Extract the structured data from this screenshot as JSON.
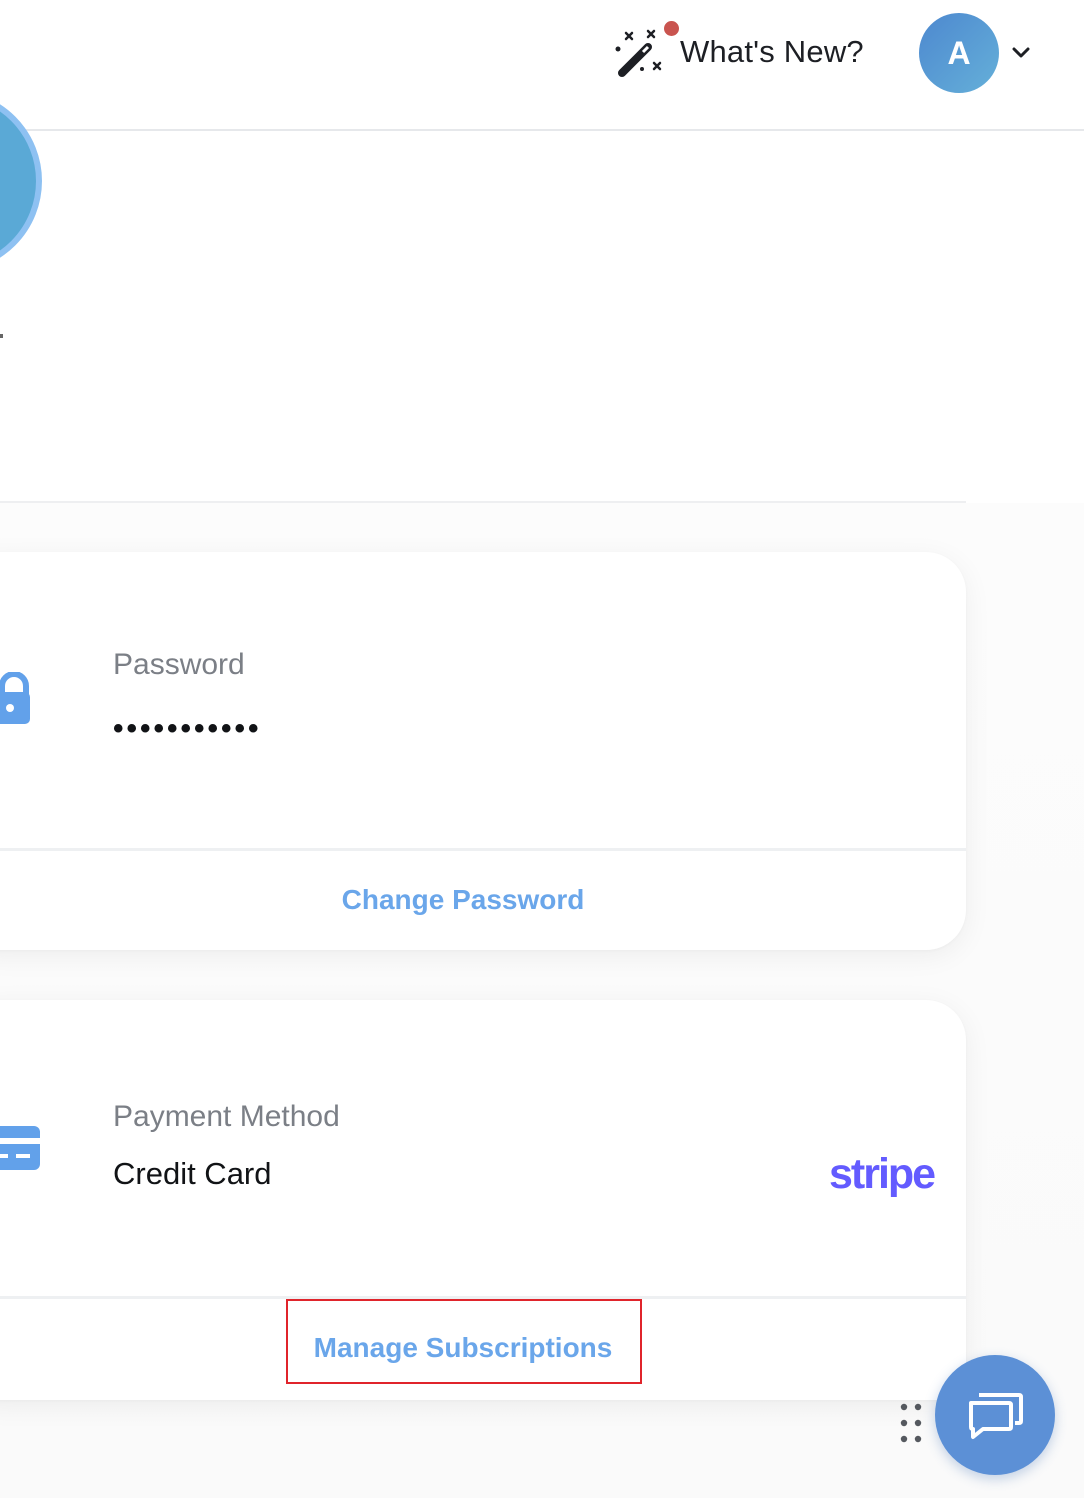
{
  "header": {
    "whats_new_label": "What's New?",
    "avatar_initial": "A",
    "notification_color": "#c9544f"
  },
  "security": {
    "password_label": "Password",
    "password_value": "•••••••••••",
    "change_password_label": "Change Password"
  },
  "payment": {
    "label": "Payment Method",
    "value": "Credit Card",
    "provider_logo": "stripe",
    "manage_label": "Manage Subscriptions"
  },
  "icons": {
    "whats_new": "magic-wand-icon",
    "lock": "lock-icon",
    "credit_card": "credit-card-icon",
    "chat": "chat-icon",
    "drag": "drag-handle-icon",
    "chevron": "chevron-down-icon"
  },
  "colors": {
    "accent": "#6aa6ea",
    "stripe": "#635bff",
    "avatar_start": "#4d88cf",
    "avatar_end": "#65b0d9",
    "chat": "#5c90d6",
    "highlight": "#e0242b"
  }
}
